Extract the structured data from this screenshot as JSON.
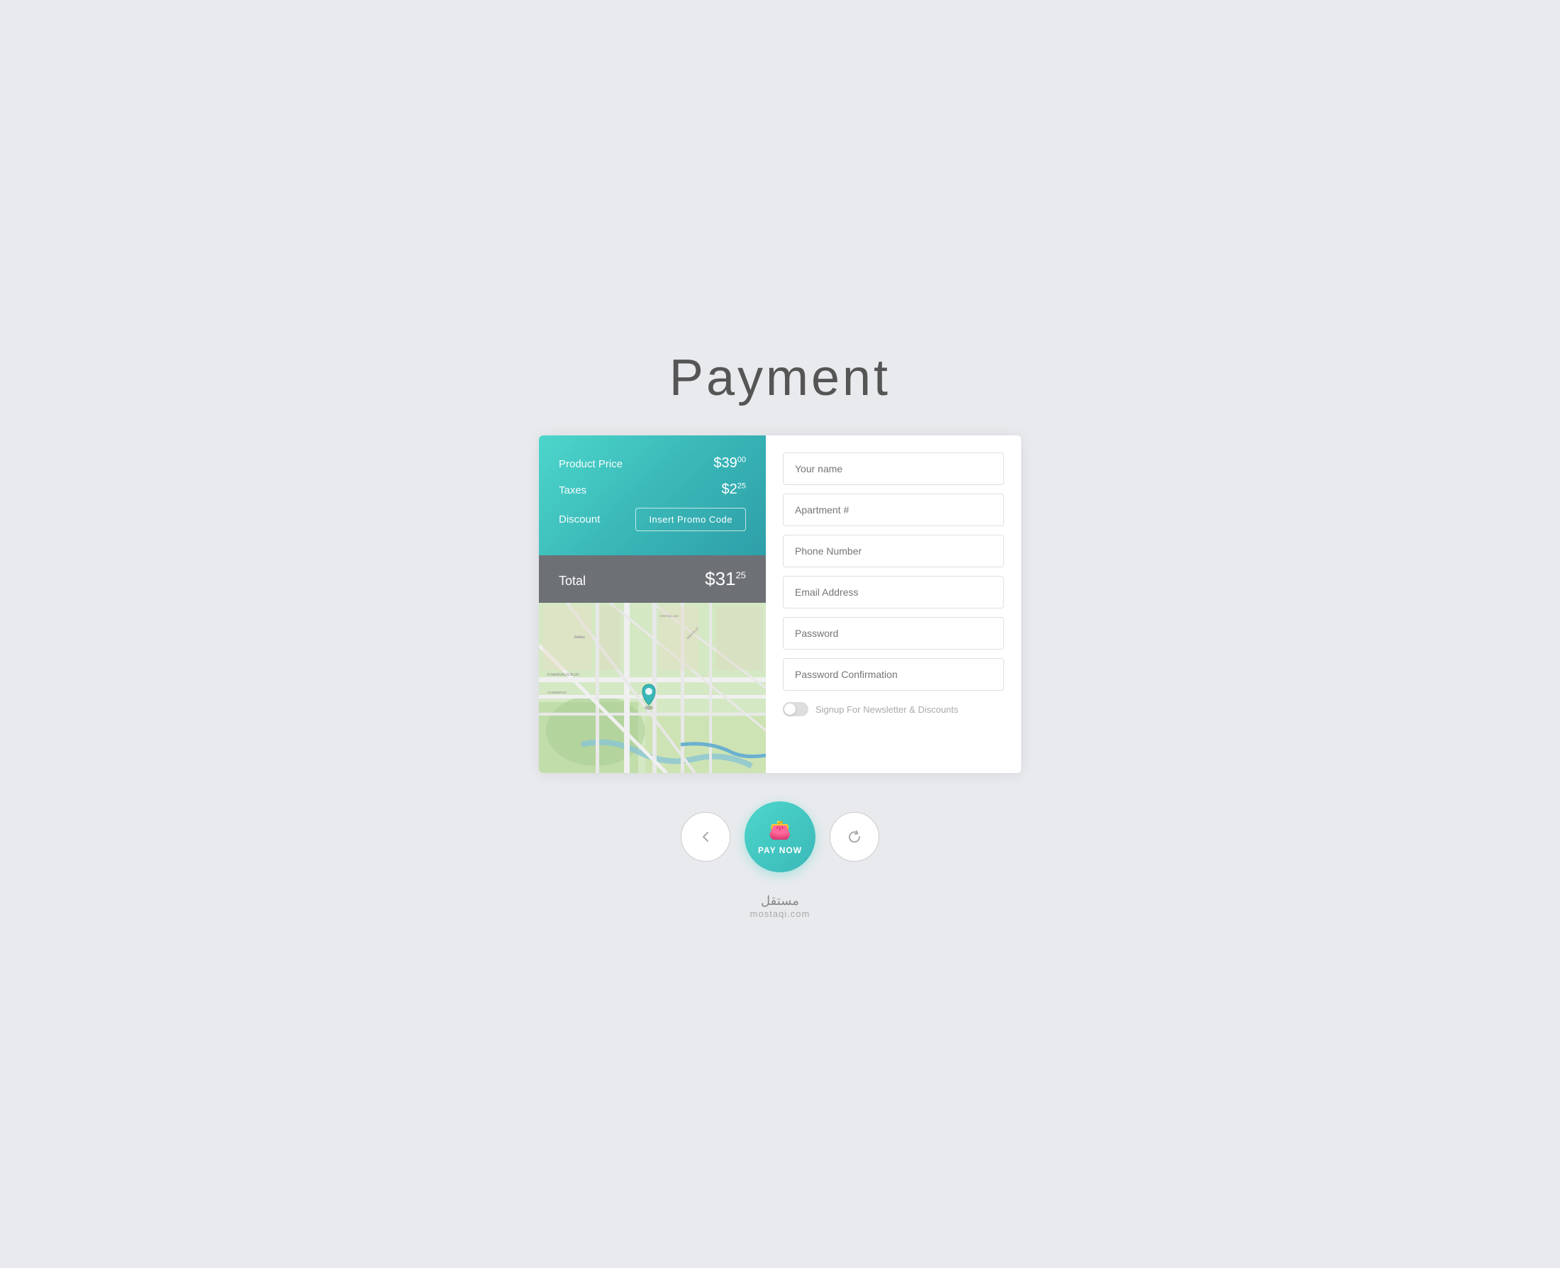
{
  "page": {
    "title": "Payment",
    "background_color": "#e8eaed"
  },
  "pricing": {
    "product_price_label": "Product Price",
    "product_price_value": "$39",
    "product_price_sup": "00",
    "taxes_label": "Taxes",
    "taxes_value": "$2",
    "taxes_sup": "25",
    "discount_label": "Discount",
    "promo_button_label": "Insert Promo Code",
    "total_label": "Total",
    "total_value": "$31",
    "total_sup": "25"
  },
  "form": {
    "name_placeholder": "Your name",
    "apartment_placeholder": "Apartment #",
    "phone_placeholder": "Phone Number",
    "email_placeholder": "Email Address",
    "password_placeholder": "Password",
    "password_confirm_placeholder": "Password Confirmation",
    "newsletter_label": "Signup For Newsletter & Discounts"
  },
  "buttons": {
    "back_label": "‹",
    "pay_now_label": "PAY NOW",
    "refresh_label": "↻"
  },
  "footer": {
    "brand_arabic": "مستقل",
    "brand_latin": "mostaqi.com"
  }
}
